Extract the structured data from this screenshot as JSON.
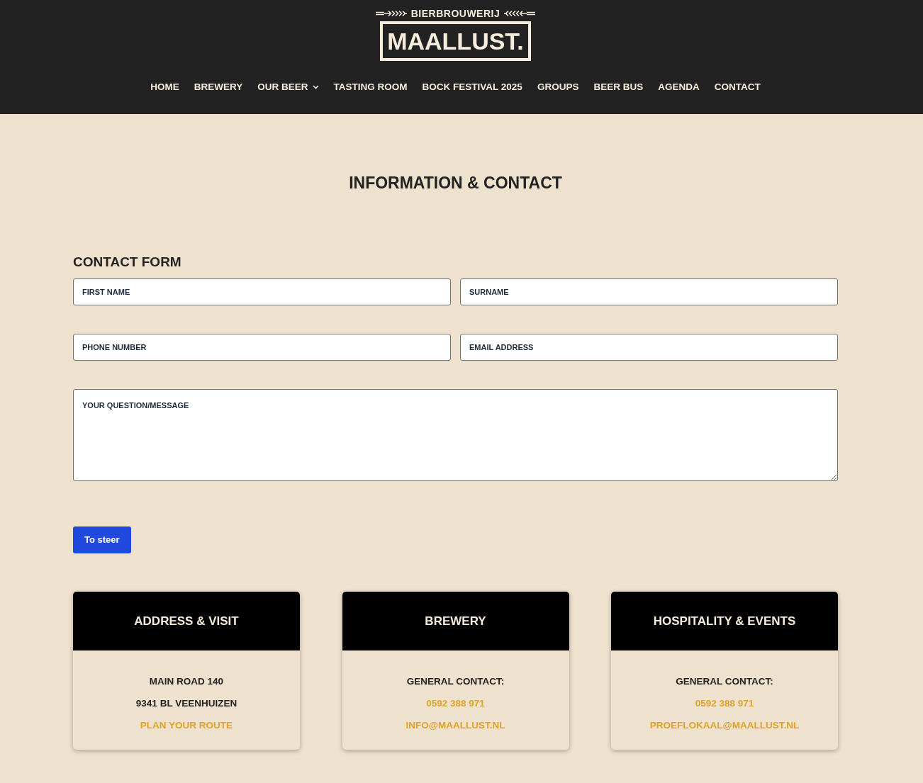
{
  "logo": {
    "tagline": "BIERBROUWERIJ",
    "name": "MAALLUST."
  },
  "nav": [
    {
      "label": "HOME",
      "submenu": false
    },
    {
      "label": "BREWERY",
      "submenu": false
    },
    {
      "label": "OUR BEER",
      "submenu": true
    },
    {
      "label": "TASTING ROOM",
      "submenu": false
    },
    {
      "label": "BOCK FESTIVAL 2025",
      "submenu": false
    },
    {
      "label": "GROUPS",
      "submenu": false
    },
    {
      "label": "BEER BUS",
      "submenu": false
    },
    {
      "label": "AGENDA",
      "submenu": false
    },
    {
      "label": "CONTACT",
      "submenu": false
    }
  ],
  "page_title": "INFORMATION & CONTACT",
  "form": {
    "title": "CONTACT FORM",
    "rows": [
      [
        {
          "kind": "input",
          "placeholder": "FIRST NAME"
        },
        {
          "kind": "input",
          "placeholder": "SURNAME"
        }
      ],
      [
        {
          "kind": "input",
          "placeholder": "PHONE NUMBER"
        },
        {
          "kind": "input",
          "placeholder": "EMAIL ADDRESS"
        }
      ],
      [
        {
          "kind": "textarea",
          "placeholder": "YOUR QUESTION/MESSAGE"
        }
      ]
    ],
    "submit": "To steer"
  },
  "cards": [
    {
      "title": "ADDRESS & VISIT",
      "lines": [
        {
          "kind": "text",
          "text": "MAIN ROAD 140"
        },
        {
          "kind": "text",
          "text": "9341 BL VEENHUIZEN"
        },
        {
          "kind": "link",
          "text": "PLAN YOUR ROUTE"
        }
      ]
    },
    {
      "title": "BREWERY",
      "lines": [
        {
          "kind": "text",
          "text": "GENERAL CONTACT:"
        },
        {
          "kind": "link",
          "text": "0592 388 971"
        },
        {
          "kind": "link",
          "text": "INFO@MAALLUST.NL"
        }
      ]
    },
    {
      "title": "HOSPITALITY & EVENTS",
      "lines": [
        {
          "kind": "text",
          "text": "GENERAL CONTACT:"
        },
        {
          "kind": "link",
          "text": "0592 388 971"
        },
        {
          "kind": "link",
          "text": "PROEFLOKAAL@MAALLUST.NL"
        }
      ]
    }
  ]
}
